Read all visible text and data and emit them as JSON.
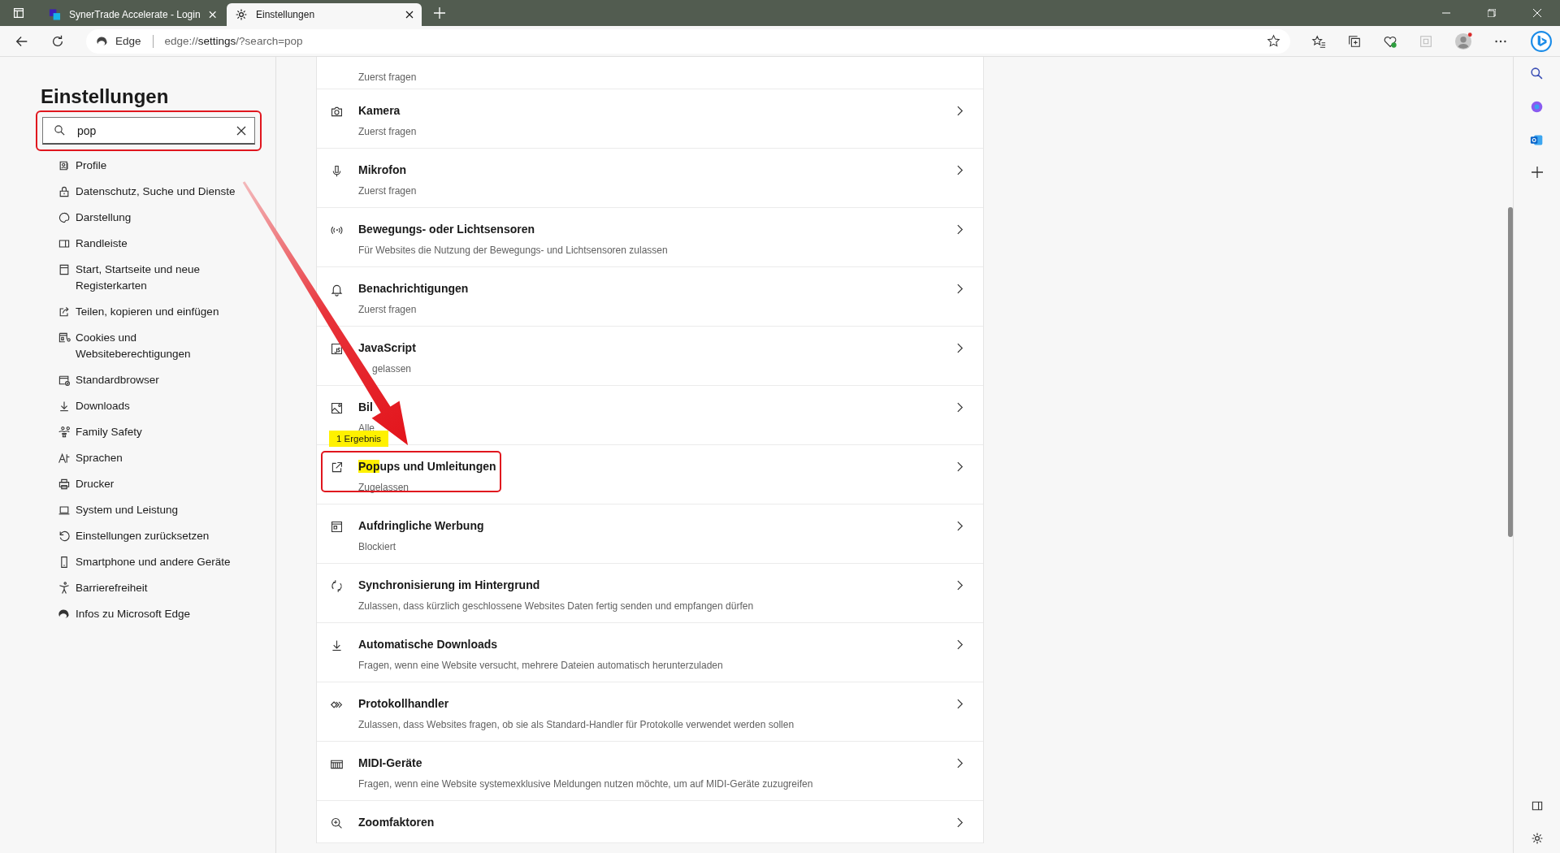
{
  "browser": {
    "tabs": [
      {
        "title": "SynerTrade Accelerate - Login",
        "selected": false
      },
      {
        "title": "Einstellungen",
        "selected": true
      }
    ],
    "address": {
      "site_label": "Edge",
      "url": "edge://**settings**/?search=pop"
    }
  },
  "sidebar": {
    "title": "Einstellungen",
    "search": {
      "value": "pop",
      "annotated": true
    },
    "items": [
      {
        "label": "Profile"
      },
      {
        "label": "Datenschutz, Suche und Dienste"
      },
      {
        "label": "Darstellung"
      },
      {
        "label": "Randleiste"
      },
      {
        "label": "Start, Startseite und neue\nRegisterkarten"
      },
      {
        "label": "Teilen, kopieren und einfügen"
      },
      {
        "label": "Cookies und\nWebsiteberechtigungen"
      },
      {
        "label": "Standardbrowser"
      },
      {
        "label": "Downloads"
      },
      {
        "label": "Family Safety"
      },
      {
        "label": "Sprachen"
      },
      {
        "label": "Drucker"
      },
      {
        "label": "System und Leistung"
      },
      {
        "label": "Einstellungen zurücksetzen"
      },
      {
        "label": "Smartphone und andere Geräte"
      },
      {
        "label": "Barrierefreiheit"
      },
      {
        "label": "Infos zu Microsoft Edge"
      }
    ]
  },
  "results": {
    "match_badge": "1 Ergebnis",
    "rows": [
      {
        "subtitle": "Zuerst fragen",
        "annotated": false
      },
      {
        "title": "Kamera",
        "subtitle": "Zuerst fragen",
        "annotated": false
      },
      {
        "title": "Mikrofon",
        "subtitle": "Zuerst fragen",
        "annotated": false
      },
      {
        "title": "Bewegungs- oder Lichtsensoren",
        "subtitle": "Für Websites die Nutzung der Bewegungs- und Lichtsensoren zulassen",
        "annotated": false
      },
      {
        "title": "Benachrichtigungen",
        "subtitle": "Zuerst fragen",
        "annotated": false
      },
      {
        "title": "JavaScript",
        "subtitle": "gelassen",
        "subtitle_covered": true,
        "annotated": false
      },
      {
        "title": "Bil",
        "subtitle": "Alle",
        "annotated": false
      },
      {
        "highlight": "Pop",
        "title": "ups und Umleitungen",
        "subtitle": "Zugelassen",
        "annotated": true
      },
      {
        "title": "Aufdringliche Werbung",
        "subtitle": "Blockiert",
        "annotated": false
      },
      {
        "title": "Synchronisierung im Hintergrund",
        "subtitle": "Zulassen, dass kürzlich geschlossene Websites Daten fertig senden und empfangen dürfen",
        "annotated": false
      },
      {
        "title": "Automatische Downloads",
        "subtitle": "Fragen, wenn eine Website versucht, mehrere Dateien automatisch herunterzuladen",
        "annotated": false
      },
      {
        "title": "Protokollhandler",
        "subtitle": "Zulassen, dass Websites fragen, ob sie als Standard-Handler für Protokolle verwendet werden sollen",
        "annotated": false
      },
      {
        "title": "MIDI-Geräte",
        "subtitle": "Fragen, wenn eine Website systemexklusive Meldungen nutzen möchte, um auf MIDI-Geräte zuzugreifen",
        "annotated": false
      },
      {
        "title": "Zoomfaktoren",
        "annotated": false
      }
    ]
  }
}
